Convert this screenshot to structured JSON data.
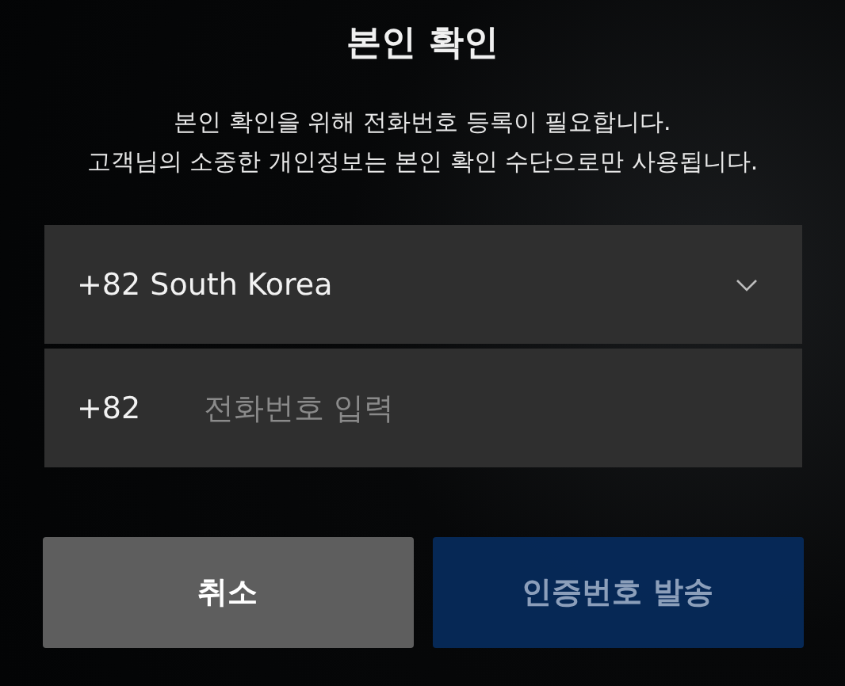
{
  "title": "본인 확인",
  "description": [
    "본인 확인을 위해 전화번호 등록이 필요합니다.",
    "고객님의 소중한 개인정보는 본인 확인 수단으로만 사용됩니다."
  ],
  "country_select": {
    "value": "+82 South Korea"
  },
  "phone": {
    "prefix": "+82",
    "placeholder": "전화번호 입력"
  },
  "buttons": [
    {
      "label": "취소",
      "kind": "secondary",
      "disabled": false
    },
    {
      "label": "인증번호 발송",
      "kind": "primary",
      "disabled": true
    }
  ]
}
